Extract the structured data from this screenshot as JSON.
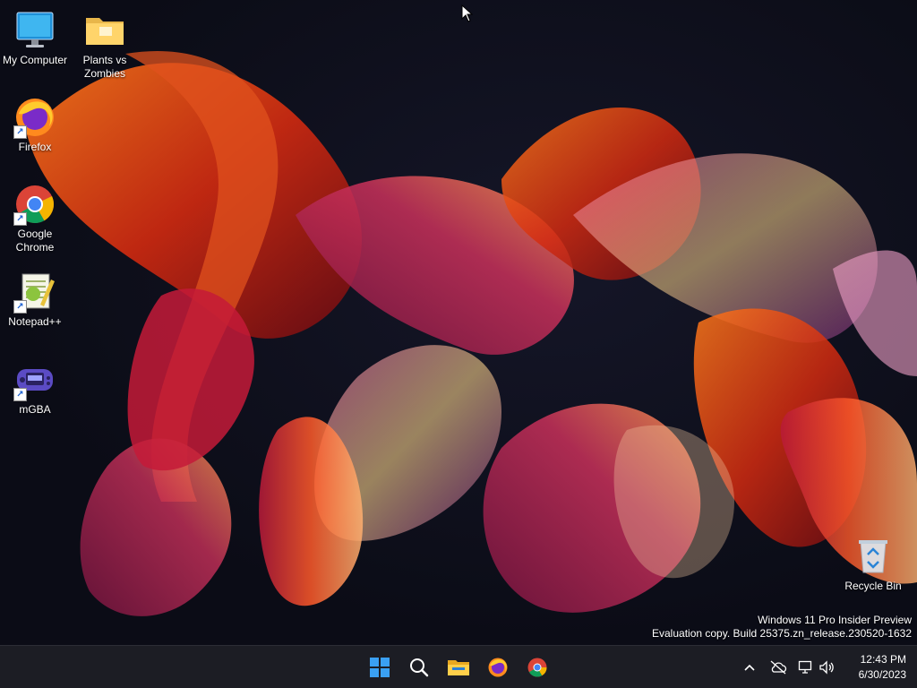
{
  "desktop": {
    "icons": [
      {
        "id": "my-computer",
        "label": "My Computer",
        "icon": "monitor-icon"
      },
      {
        "id": "plants-vs-zombies",
        "label": "Plants vs Zombies",
        "icon": "folder-icon"
      },
      {
        "id": "firefox",
        "label": "Firefox",
        "icon": "firefox-icon"
      },
      {
        "id": "google-chrome",
        "label": "Google Chrome",
        "icon": "chrome-icon"
      },
      {
        "id": "notepad-plus-plus",
        "label": "Notepad++",
        "icon": "notepad-plus-plus-icon"
      },
      {
        "id": "mgba",
        "label": "mGBA",
        "icon": "mgba-icon"
      },
      {
        "id": "recycle-bin",
        "label": "Recycle Bin",
        "icon": "recycle-bin-icon"
      }
    ],
    "watermark": {
      "line1": "Windows 11 Pro Insider Preview",
      "line2": "Evaluation copy. Build 25375.zn_release.230520-1632"
    }
  },
  "taskbar": {
    "apps": [
      "start-icon",
      "search-icon",
      "file-explorer-icon",
      "firefox-icon",
      "chrome-icon"
    ],
    "tray": [
      "chevron-up-icon",
      "cloud-off-icon",
      "network-icon",
      "speaker-icon"
    ],
    "clock": {
      "time": "12:43 PM",
      "date": "6/30/2023"
    }
  },
  "colors": {
    "taskbar_bg": "#1c1d24",
    "accent": "#0078d4"
  }
}
